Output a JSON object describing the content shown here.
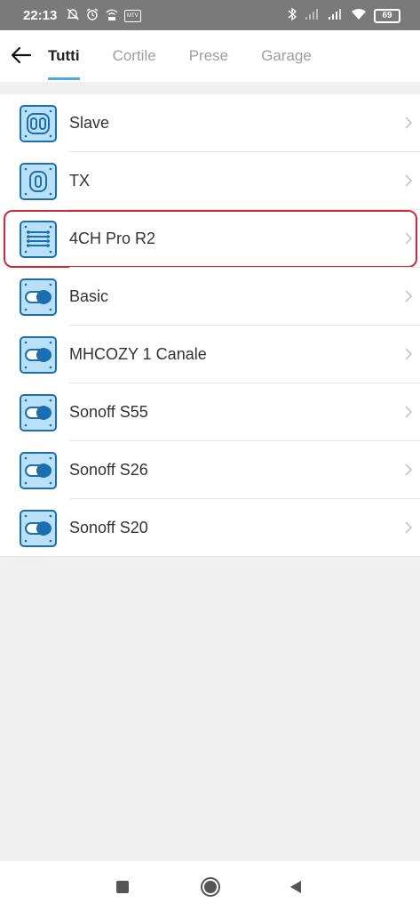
{
  "status_bar": {
    "time": "22:13",
    "battery": "69",
    "left_icons": [
      "bell-off-icon",
      "alarm-icon",
      "wifi-calling-icon",
      "mtv-badge-icon"
    ],
    "right_icons": [
      "bluetooth-icon",
      "signal-icon",
      "signal-icon",
      "wifi-icon",
      "battery-icon"
    ],
    "badge_text": "MTV"
  },
  "header": {
    "tabs": [
      {
        "label": "Tutti",
        "active": true
      },
      {
        "label": "Cortile",
        "active": false
      },
      {
        "label": "Prese",
        "active": false
      },
      {
        "label": "Garage",
        "active": false
      }
    ]
  },
  "devices": [
    {
      "name": "Slave",
      "icon": "double-button-switch-icon"
    },
    {
      "name": "TX",
      "icon": "single-button-switch-icon"
    },
    {
      "name": "4CH Pro R2",
      "icon": "four-channel-relay-icon",
      "highlighted": true
    },
    {
      "name": "Basic",
      "icon": "toggle-switch-icon"
    },
    {
      "name": "MHCOZY 1 Canale",
      "icon": "toggle-switch-icon"
    },
    {
      "name": "Sonoff S55",
      "icon": "toggle-switch-icon"
    },
    {
      "name": "Sonoff S26",
      "icon": "toggle-switch-icon"
    },
    {
      "name": "Sonoff S20",
      "icon": "toggle-switch-icon"
    }
  ],
  "colors": {
    "accent": "#4fa8dc",
    "icon_fill": "#b9e0f7",
    "icon_stroke": "#1a6fb0",
    "highlight": "#cc2b36"
  }
}
